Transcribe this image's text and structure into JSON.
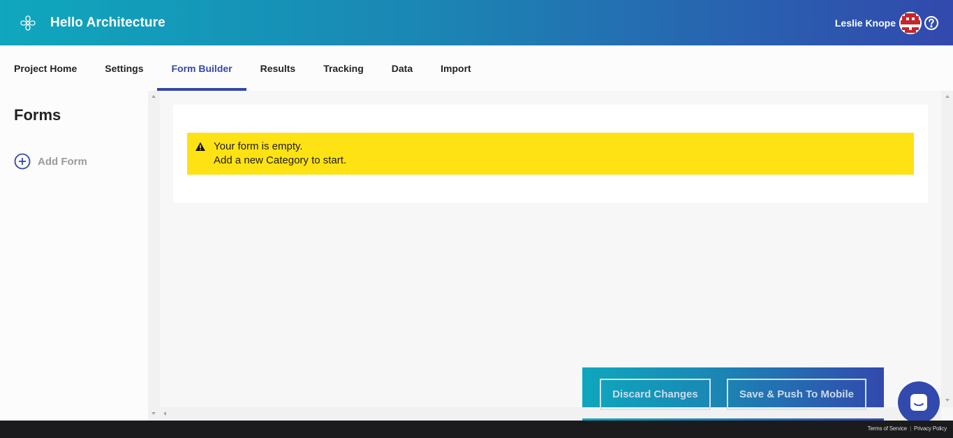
{
  "header": {
    "app_title": "Hello Architecture",
    "user_name": "Leslie Knope",
    "logo_icon": "fan-logo-icon",
    "help_icon": "help-circle-icon"
  },
  "nav": {
    "tabs": [
      {
        "label": "Project Home",
        "active": false
      },
      {
        "label": "Settings",
        "active": false
      },
      {
        "label": "Form Builder",
        "active": true
      },
      {
        "label": "Results",
        "active": false
      },
      {
        "label": "Tracking",
        "active": false
      },
      {
        "label": "Data",
        "active": false
      },
      {
        "label": "Import",
        "active": false
      }
    ]
  },
  "sidebar": {
    "title": "Forms",
    "add_form_label": "Add Form"
  },
  "main": {
    "alert": {
      "line1": "Your form is empty.",
      "line2": "Add a new Category to start.",
      "icon": "warning-triangle-icon",
      "color": "#ffe213"
    }
  },
  "actions": {
    "discard_label": "Discard Changes",
    "save_label": "Save & Push To Mobile"
  },
  "footer": {
    "terms_label": "Terms of Service",
    "separator": "|",
    "privacy_label": "Privacy Policy"
  },
  "colors": {
    "accent": "#3447a8",
    "gradient_start": "#0fa7bd",
    "gradient_end": "#3249ad"
  }
}
